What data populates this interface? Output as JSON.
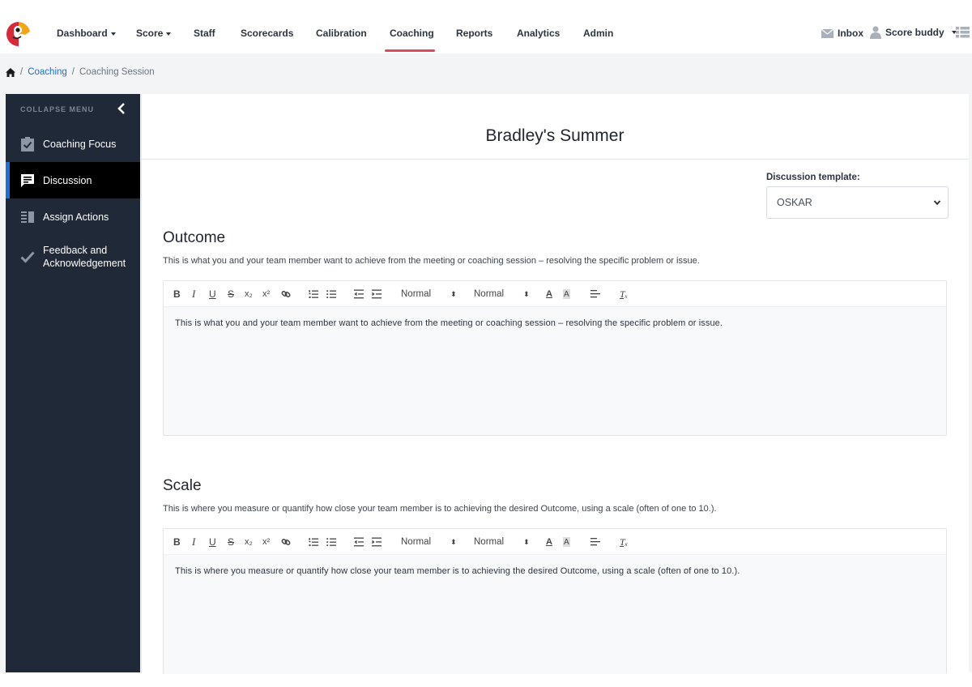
{
  "nav": {
    "items": [
      {
        "label": "Dashboard",
        "dropdown": true
      },
      {
        "label": "Score",
        "dropdown": true
      },
      {
        "label": "Staff",
        "dropdown": false
      },
      {
        "label": "Scorecards",
        "dropdown": false
      },
      {
        "label": "Calibration",
        "dropdown": false
      },
      {
        "label": "Coaching",
        "dropdown": false,
        "active": true
      },
      {
        "label": "Reports",
        "dropdown": false
      },
      {
        "label": "Analytics",
        "dropdown": false
      },
      {
        "label": "Admin",
        "dropdown": false
      }
    ],
    "inbox_label": "Inbox",
    "user_label": "Score buddy",
    "active_color": "#e0485b"
  },
  "breadcrumb": {
    "home_icon": "home-icon",
    "items": [
      "Coaching",
      "Coaching Session"
    ]
  },
  "sidebar": {
    "collapse_label": "COLLAPSE MENU",
    "items": [
      {
        "label": "Coaching Focus",
        "icon": "clipboard-check-icon"
      },
      {
        "label": "Discussion",
        "icon": "comment-icon",
        "active": true
      },
      {
        "label": "Assign Actions",
        "icon": "list-columns-icon"
      },
      {
        "label": "Feedback and Acknowledgement",
        "icon": "check-icon"
      }
    ]
  },
  "page": {
    "title": "Bradley's Summer",
    "template_label": "Discussion template:",
    "template_value": "OSKAR"
  },
  "toolbar": {
    "bold": "B",
    "italic": "I",
    "underline": "U",
    "strike": "S",
    "subscript": "x₂",
    "superscript": "x²",
    "heading_select": "Normal",
    "size_select": "Normal"
  },
  "sections": [
    {
      "title": "Outcome",
      "description": "This is what you and your team member want to achieve from the meeting or coaching session – resolving the specific problem or issue.",
      "editor_text": "This is what you and your team member want to achieve from the meeting or coaching session – resolving the specific problem or issue."
    },
    {
      "title": "Scale",
      "description": "This is where you measure or quantify how close your team member is to achieving the desired Outcome, using a scale (often of one to 10.).",
      "editor_text": "This is where you measure or quantify how close your team member is to achieving the desired Outcome, using a scale (often of one to 10.)."
    }
  ]
}
